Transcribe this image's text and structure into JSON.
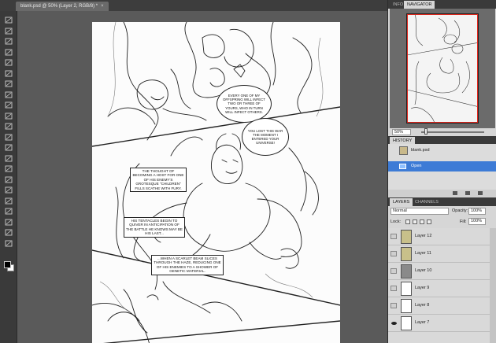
{
  "document": {
    "tab_title": "blank.psd @ 50% (Layer 2, RGB/8) *",
    "close_glyph": "×"
  },
  "toolbox": {
    "tools": [
      "move-tool",
      "marquee-tool",
      "lasso-tool",
      "quick-select-tool",
      "crop-tool",
      "eyedropper-tool",
      "healing-brush-tool",
      "brush-tool",
      "clone-stamp-tool",
      "history-brush-tool",
      "eraser-tool",
      "gradient-tool",
      "blur-tool",
      "dodge-tool",
      "pen-tool",
      "type-tool",
      "path-select-tool",
      "shape-tool",
      "3d-rotate-tool",
      "3d-orbit-tool",
      "hand-tool",
      "zoom-tool"
    ],
    "foreground_color": "#000000",
    "background_color": "#ffffff"
  },
  "comic": {
    "balloon1": "EVERY ONE OF MY OFFSPRING WILL INFECT TWO OR THREE OF YOURS, WHO IN TURN WILL INFECT OTHERS.",
    "balloon2": "YOU LOST THIS WAR THE MOMENT I ENTERED YOUR UNIVERSE!",
    "caption1": "THE THOUGHT OF BECOMING A HOST FOR ONE OF HIS ENEMY'S GROTESQUE \"CHILDREN\" FILLS SCATHE WITH FURY.",
    "caption2": "HIS TENTACLES BEGIN TO QUIVER IN ANTICIPATION OF THE BATTLE HE KNOWS MAY BE HIS LAST...",
    "caption3": "...WHEN A SCARLET BEAM SLICES THROUGH THE HAZE, REDUCING ONE OF HIS ENEMIES TO A SHOWER OF GENETIC MATERIAL."
  },
  "navigator": {
    "tabs": [
      "INFO",
      "NAVIGATOR"
    ],
    "active_tab": "NAVIGATOR",
    "zoom": "50%",
    "proxy_color": "#e0251b"
  },
  "history": {
    "tab": "HISTORY",
    "items": [
      {
        "label": "blank.psd",
        "selected": false
      },
      {
        "label": "Open",
        "selected": true
      }
    ]
  },
  "layers": {
    "tabs": [
      "LAYERS",
      "CHANNELS"
    ],
    "blend_mode": "Normal",
    "opacity_label": "Opacity:",
    "opacity": "100%",
    "lock_label": "Lock:",
    "fill_label": "Fill:",
    "fill": "100%",
    "items": [
      {
        "name": "Layer 12",
        "visible": false,
        "thumb": "art"
      },
      {
        "name": "Layer 11",
        "visible": false,
        "thumb": "art"
      },
      {
        "name": "Layer 10",
        "visible": false,
        "thumb": "dark"
      },
      {
        "name": "Layer 9",
        "visible": false,
        "thumb": "white"
      },
      {
        "name": "Layer 8",
        "visible": false,
        "thumb": "white"
      },
      {
        "name": "Layer 7",
        "visible": true,
        "thumb": "white"
      }
    ]
  },
  "colors": {
    "ui_dark": "#3a3a3a",
    "panel_bg": "#d6d6d6",
    "selection": "#3d7bd6"
  }
}
